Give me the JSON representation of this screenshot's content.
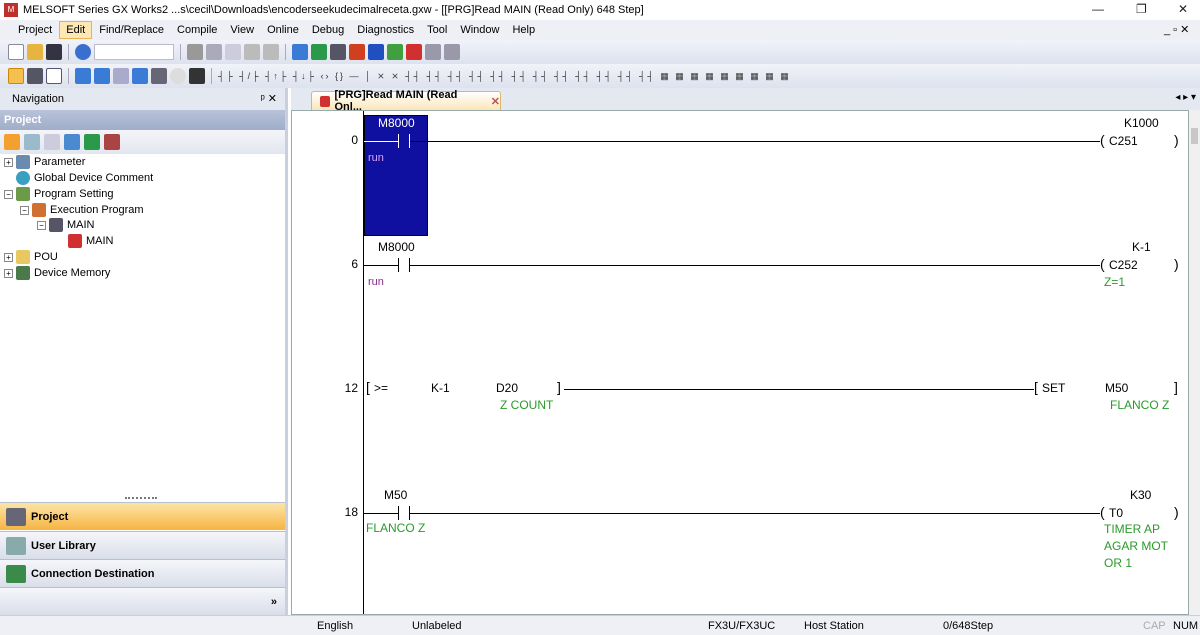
{
  "title": "MELSOFT Series GX Works2 ...s\\cecil\\Downloads\\encoderseekudecimalreceta.gxw - [[PRG]Read MAIN (Read Only) 648 Step]",
  "menu": [
    "Project",
    "Edit",
    "Find/Replace",
    "Compile",
    "View",
    "Online",
    "Debug",
    "Diagnostics",
    "Tool",
    "Window",
    "Help"
  ],
  "navigation": {
    "title": "Navigation",
    "section": "Project",
    "tree": [
      "Parameter",
      "Global Device Comment",
      "Program Setting",
      "Execution Program",
      "MAIN",
      "MAIN",
      "POU",
      "Device Memory"
    ],
    "buttons": [
      "Project",
      "User Library",
      "Connection Destination"
    ]
  },
  "tab": "[PRG]Read MAIN (Read Onl...",
  "ladder": {
    "r0": {
      "step": "0",
      "contact": "M8000",
      "contact_cmt": "run",
      "coil": "C251",
      "const": "K1000"
    },
    "r6": {
      "step": "6",
      "contact": "M8000",
      "contact_cmt": "run",
      "coil": "C252",
      "const": "K-1",
      "coil_cmt": "Z=1"
    },
    "r12": {
      "step": "12",
      "op": ">=",
      "s1": "K-1",
      "s2": "D20",
      "s2_cmt": "Z COUNT",
      "instr": "SET",
      "dst": "M50",
      "dst_cmt": "FLANCO Z"
    },
    "r18": {
      "step": "18",
      "contact": "M50",
      "contact_cmt": "FLANCO Z",
      "coil": "T0",
      "const": "K30",
      "coil_cmt": [
        "TIMER AP",
        "AGAR MOT",
        "OR 1"
      ]
    }
  },
  "status": {
    "lang": "English",
    "label": "Unlabeled",
    "cpu": "FX3U/FX3UC",
    "station": "Host Station",
    "steps": "0/648Step",
    "cap": "CAP",
    "num": "NUM"
  }
}
